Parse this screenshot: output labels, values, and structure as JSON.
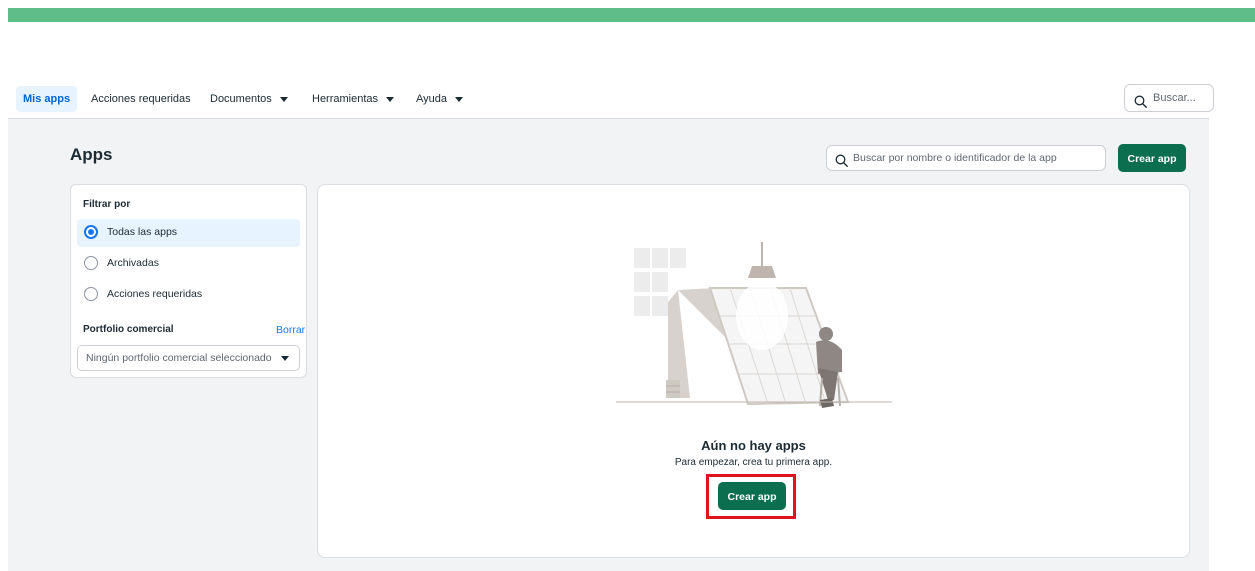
{
  "nav": {
    "items": [
      {
        "label": "Mis apps",
        "active": true
      },
      {
        "label": "Acciones requeridas"
      },
      {
        "label": "Documentos",
        "dropdown": true
      },
      {
        "label": "Herramientas",
        "dropdown": true
      },
      {
        "label": "Ayuda",
        "dropdown": true
      }
    ],
    "search_placeholder": "Buscar..."
  },
  "page": {
    "title": "Apps",
    "search_placeholder": "Buscar por nombre o identificador de la app",
    "create_button": "Crear app"
  },
  "filter": {
    "title": "Filtrar por",
    "options": [
      {
        "label": "Todas las apps",
        "selected": true
      },
      {
        "label": "Archivadas",
        "selected": false
      },
      {
        "label": "Acciones requeridas",
        "selected": false
      }
    ],
    "portfolio_title": "Portfolio comercial",
    "clear_label": "Borrar",
    "portfolio_value": "Ningún portfolio comercial seleccionado"
  },
  "empty_state": {
    "title": "Aún no hay apps",
    "subtitle": "Para empezar, crea tu primera app.",
    "button": "Crear app"
  },
  "colors": {
    "accent_green": "#0b6e4f",
    "top_bar": "#5fbd8a",
    "link_blue": "#1877f2",
    "highlight_red": "#e0121d"
  },
  "icons": [
    "search-icon",
    "caret-down-icon",
    "radio-icon",
    "empty-state-illustration"
  ]
}
